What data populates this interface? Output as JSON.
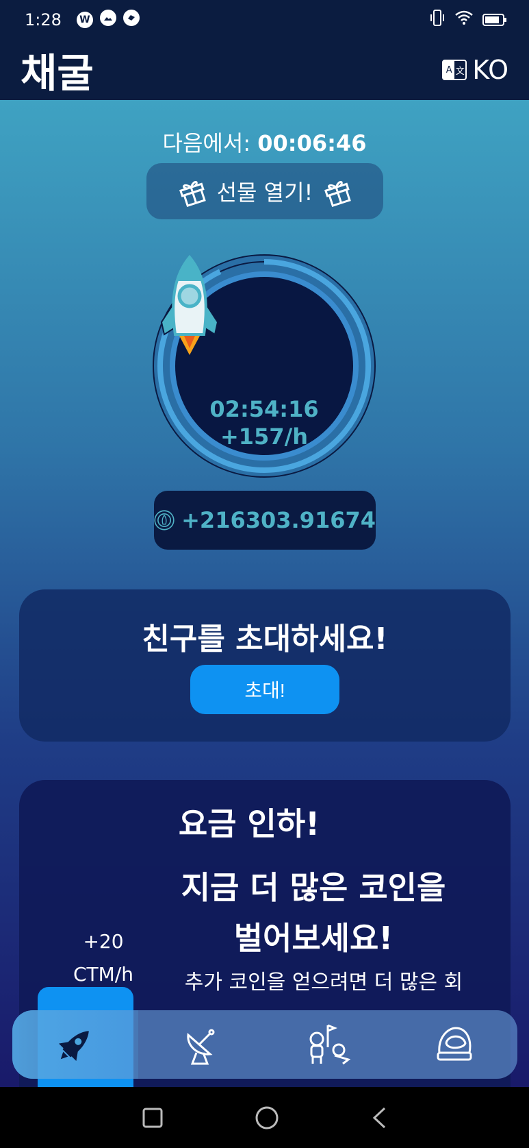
{
  "status_bar": {
    "time": "1:28",
    "app_icon_label": "W"
  },
  "header": {
    "title": "채굴",
    "language": "KO",
    "language_icon": "translate-icon"
  },
  "gift": {
    "next_label": "다음에서:",
    "countdown": "00:06:46",
    "button_label": "선물 열기!"
  },
  "miner": {
    "remaining_time": "02:54:16",
    "rate": "+157/h",
    "progress": 0.93
  },
  "balance": {
    "value": "+216303.91674"
  },
  "invite": {
    "title": "친구를 초대하세요!",
    "button_label": "초대!"
  },
  "promo": {
    "title": "요금 인하!",
    "headline_line1": "지금 더 많은 코인을",
    "headline_line2": "벌어보세요!",
    "description": "추가 코인을 얻으려면 더 많은 회",
    "plan_amount": "+20",
    "plan_unit": "CTM/h"
  },
  "nav": {
    "items": [
      {
        "icon": "rocket-icon",
        "active": true
      },
      {
        "icon": "satellite-dish-icon",
        "active": false
      },
      {
        "icon": "astronauts-icon",
        "active": false
      },
      {
        "icon": "helmet-icon",
        "active": false
      }
    ]
  },
  "colors": {
    "accent": "#0e92f2",
    "teal_text": "#4fb2c6",
    "header_bg": "#0b1c40"
  }
}
